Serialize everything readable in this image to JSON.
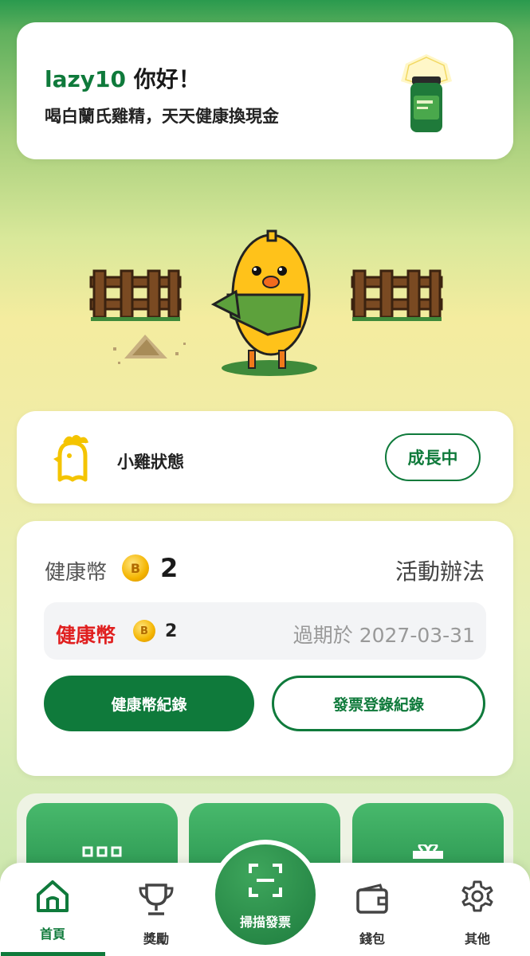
{
  "greeting": {
    "username": "lazy10",
    "hello": " 你好！",
    "subtitle": "喝白蘭氏雞精，天天健康換現金"
  },
  "status": {
    "label": "小雞狀態",
    "state": "成長中"
  },
  "coins": {
    "title": "健康幣",
    "total": "2",
    "rules_link": "活動辦法",
    "row": {
      "label": "健康幣",
      "amount": "2",
      "expiry": "過期於 2027-03-31"
    },
    "history_button": "健康幣紀錄",
    "invoice_button": "發票登錄紀錄"
  },
  "nav": {
    "items": [
      {
        "label": "首頁",
        "icon": "home-icon",
        "active": true
      },
      {
        "label": "獎勵",
        "icon": "trophy-icon",
        "active": false
      },
      {
        "label": "錢包",
        "icon": "wallet-icon",
        "active": false
      },
      {
        "label": "其他",
        "icon": "gear-icon",
        "active": false
      }
    ],
    "scan_label": "掃描發票"
  },
  "colors": {
    "brand_green": "#0f7a3b",
    "coin_red": "#e02020",
    "coin_gold": "#f4b400"
  }
}
